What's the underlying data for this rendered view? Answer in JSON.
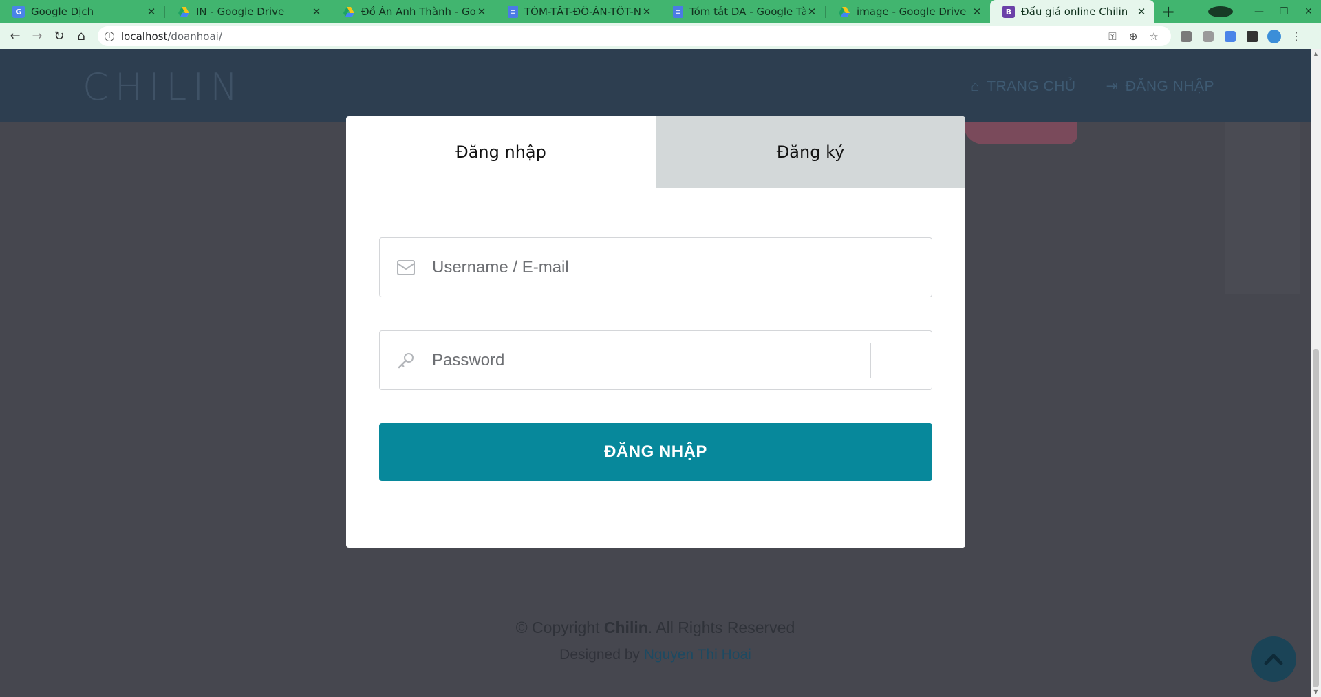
{
  "browser": {
    "tabs": [
      {
        "title": "Google Dịch",
        "favicon": "google-translate-icon"
      },
      {
        "title": "IN - Google Drive",
        "favicon": "google-drive-icon"
      },
      {
        "title": "Đồ Án Anh Thành - Google Drive",
        "favicon": "google-drive-icon"
      },
      {
        "title": "TÓM-TẮT-ĐỒ-ÁN-TỐT-NGHIỆP",
        "favicon": "google-docs-icon"
      },
      {
        "title": "Tóm tắt DA - Google Tài liệu",
        "favicon": "google-docs-icon"
      },
      {
        "title": "image - Google Drive",
        "favicon": "google-drive-icon"
      },
      {
        "title": "Đấu giá online Chilin",
        "favicon": "bootstrap-icon",
        "active": true
      }
    ],
    "url_host": "localhost",
    "url_path": "/doanhoai/",
    "tab_color": "#41b56f",
    "toolbar_color": "#e6f6ec"
  },
  "site": {
    "logo": "CHILIN",
    "nav": {
      "home": "TRANG CHỦ",
      "login": "ĐĂNG NHẬP"
    },
    "header_color": "#2d3e50"
  },
  "modal": {
    "tab_login": "Đăng nhập",
    "tab_register": "Đăng ký",
    "username_placeholder": "Username / E-mail",
    "password_placeholder": "Password",
    "submit_label": "ĐĂNG NHẬP",
    "button_color": "#07889b"
  },
  "footer": {
    "copyright_prefix": "© Copyright",
    "brand": "Chilin",
    "copyright_suffix": ". All Rights Reserved",
    "designed_prefix": "Designed by",
    "designer": "Nguyen Thi Hoai"
  }
}
